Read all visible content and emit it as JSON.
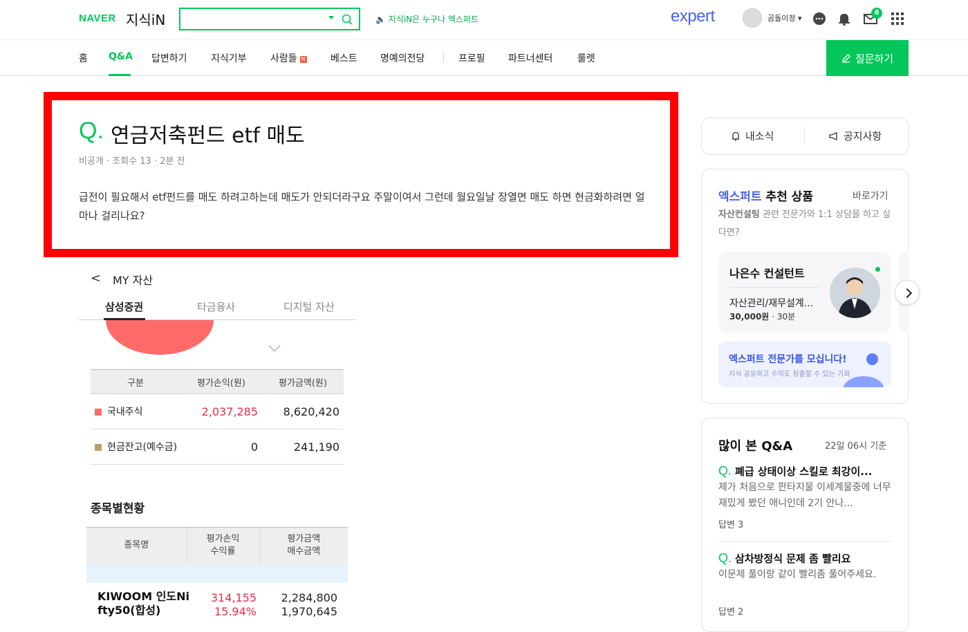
{
  "header": {
    "logo_naver": "NAVER",
    "logo_kin": "지식iN",
    "search_value": "",
    "notice": "지식iN은 누구나 엑스퍼트",
    "expert_logo": "expert",
    "username": "곰돌이정",
    "mail_count": "6"
  },
  "nav": {
    "items": [
      "홈",
      "Q&A",
      "답변하기",
      "지식기부",
      "사람들",
      "베스트",
      "명예의전당",
      "프로필",
      "파트너센터",
      "룰렛"
    ],
    "new_badge": "N",
    "ask_button": "질문하기"
  },
  "question": {
    "q_mark": "Q.",
    "title": "연금저축펀드 etf 매도",
    "meta": "비공개 · 조회수 13 · 2분 전",
    "body": "급전이 필요해서 etf펀드를 매도 하려고하는데 매도가 안되더라구요 주말이여서 그런데 월요일날 장열면 매도 하면 현금화하려면 얼마나 걸리나요?"
  },
  "attachment": {
    "title": "MY 자산",
    "tabs": [
      "삼성증권",
      "타금융사",
      "디지털 자산"
    ],
    "summary_headers": [
      "구분",
      "평가손익(원)",
      "평가금액(원)"
    ],
    "summary_rows": [
      {
        "label": "국내주식",
        "pnl": "2,037,285",
        "value": "8,620,420",
        "color": "#ff6b6b"
      },
      {
        "label": "현금잔고(예수금)",
        "pnl": "0",
        "value": "241,190",
        "color": "#b8a06a"
      }
    ],
    "holdings_title": "종목별현황",
    "holdings_headers": [
      "종목명",
      "평가손익\n수익률",
      "평가금액\n매수금액"
    ],
    "holding": {
      "name_line1": "KIWOOM 인도Ni",
      "name_line2": "fty50(합성)",
      "pnl": "314,155",
      "rate": "15.94%",
      "eval": "2,284,800",
      "buy": "1,970,645"
    }
  },
  "sidebar": {
    "my_news": "내소식",
    "notices": "공지사항",
    "rec_title_blue": "엑스퍼트",
    "rec_title_rest": " 추천 상품",
    "rec_link": "바로가기",
    "rec_desc_bold": "자산컨설팅",
    "rec_desc_rest": " 관련 전문가와 1:1 상담을 하고 싶다면?",
    "expert_name": "나은수 컨설턴트",
    "expert_field": "자산관리/재무설계...",
    "expert_price": "30,000원",
    "expert_time": "30분",
    "recruit_title": "엑스퍼트 전문가를 모십니다!",
    "recruit_sub": "지식 공유하고 수익도 창출할 수 있는 기회",
    "popular_title": "많이 본 Q&A",
    "popular_time": "22일 06시 기준",
    "popular": [
      {
        "q": "Q.",
        "title": "폐급 상태이상 스킬로 최강이...",
        "body": "제가 처음으로 판타지물 이세계물중에 너무 재밌게 봤던 애니인데 2기 안나...",
        "answers": "답변 3"
      },
      {
        "q": "Q.",
        "title": "삼차방정식 문제 좀 빨리요",
        "body": "이문제 풀이랑 같이 빨리좀 풀어주세요.",
        "answers": "답변 2"
      }
    ]
  }
}
